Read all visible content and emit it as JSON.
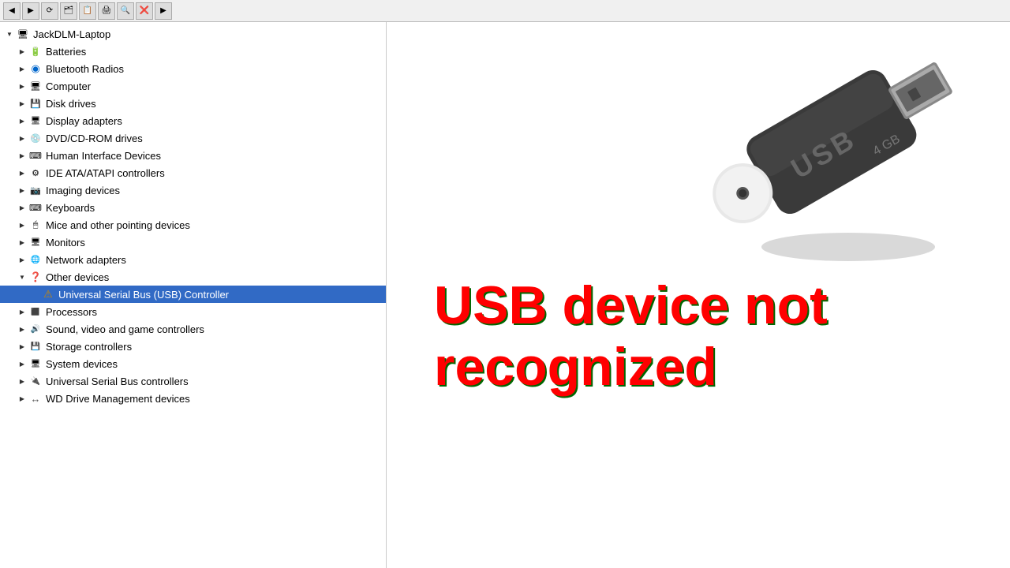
{
  "toolbar": {
    "buttons": [
      "◀",
      "▶",
      "⟳",
      "🗂",
      "📋",
      "🖨",
      "🔍",
      "❌",
      "▶"
    ]
  },
  "tree": {
    "root": {
      "label": "JackDLM-Laptop",
      "expander": "open"
    },
    "items": [
      {
        "id": "batteries",
        "label": "Batteries",
        "indent": 1,
        "expander": "closed",
        "icon": "battery",
        "selected": false
      },
      {
        "id": "bluetooth",
        "label": "Bluetooth Radios",
        "indent": 1,
        "expander": "closed",
        "icon": "bluetooth",
        "selected": false
      },
      {
        "id": "computer",
        "label": "Computer",
        "indent": 1,
        "expander": "closed",
        "icon": "computer",
        "selected": false
      },
      {
        "id": "disk",
        "label": "Disk drives",
        "indent": 1,
        "expander": "closed",
        "icon": "disk",
        "selected": false
      },
      {
        "id": "display",
        "label": "Display adapters",
        "indent": 1,
        "expander": "closed",
        "icon": "display",
        "selected": false
      },
      {
        "id": "dvd",
        "label": "DVD/CD-ROM drives",
        "indent": 1,
        "expander": "closed",
        "icon": "dvd",
        "selected": false
      },
      {
        "id": "hid",
        "label": "Human Interface Devices",
        "indent": 1,
        "expander": "closed",
        "icon": "hid",
        "selected": false
      },
      {
        "id": "ide",
        "label": "IDE ATA/ATAPI controllers",
        "indent": 1,
        "expander": "closed",
        "icon": "ide",
        "selected": false
      },
      {
        "id": "imaging",
        "label": "Imaging devices",
        "indent": 1,
        "expander": "closed",
        "icon": "imaging",
        "selected": false
      },
      {
        "id": "keyboards",
        "label": "Keyboards",
        "indent": 1,
        "expander": "closed",
        "icon": "keyboard",
        "selected": false
      },
      {
        "id": "mice",
        "label": "Mice and other pointing devices",
        "indent": 1,
        "expander": "closed",
        "icon": "mouse",
        "selected": false
      },
      {
        "id": "monitors",
        "label": "Monitors",
        "indent": 1,
        "expander": "closed",
        "icon": "monitor",
        "selected": false
      },
      {
        "id": "network",
        "label": "Network adapters",
        "indent": 1,
        "expander": "closed",
        "icon": "network",
        "selected": false
      },
      {
        "id": "other",
        "label": "Other devices",
        "indent": 1,
        "expander": "open",
        "icon": "other",
        "selected": false
      },
      {
        "id": "usb-controller",
        "label": "Universal Serial Bus (USB) Controller",
        "indent": 2,
        "expander": "none",
        "icon": "usb-controller",
        "selected": true
      },
      {
        "id": "processors",
        "label": "Processors",
        "indent": 1,
        "expander": "closed",
        "icon": "processor",
        "selected": false
      },
      {
        "id": "sound",
        "label": "Sound, video and game controllers",
        "indent": 1,
        "expander": "closed",
        "icon": "sound",
        "selected": false
      },
      {
        "id": "storage",
        "label": "Storage controllers",
        "indent": 1,
        "expander": "closed",
        "icon": "storage",
        "selected": false
      },
      {
        "id": "system",
        "label": "System devices",
        "indent": 1,
        "expander": "closed",
        "icon": "system",
        "selected": false
      },
      {
        "id": "usb",
        "label": "Universal Serial Bus controllers",
        "indent": 1,
        "expander": "closed",
        "icon": "usb",
        "selected": false
      },
      {
        "id": "wd",
        "label": "WD Drive Management devices",
        "indent": 1,
        "expander": "closed",
        "icon": "wd",
        "selected": false
      }
    ]
  },
  "error": {
    "line1": "USB device not",
    "line2": "recognized"
  }
}
